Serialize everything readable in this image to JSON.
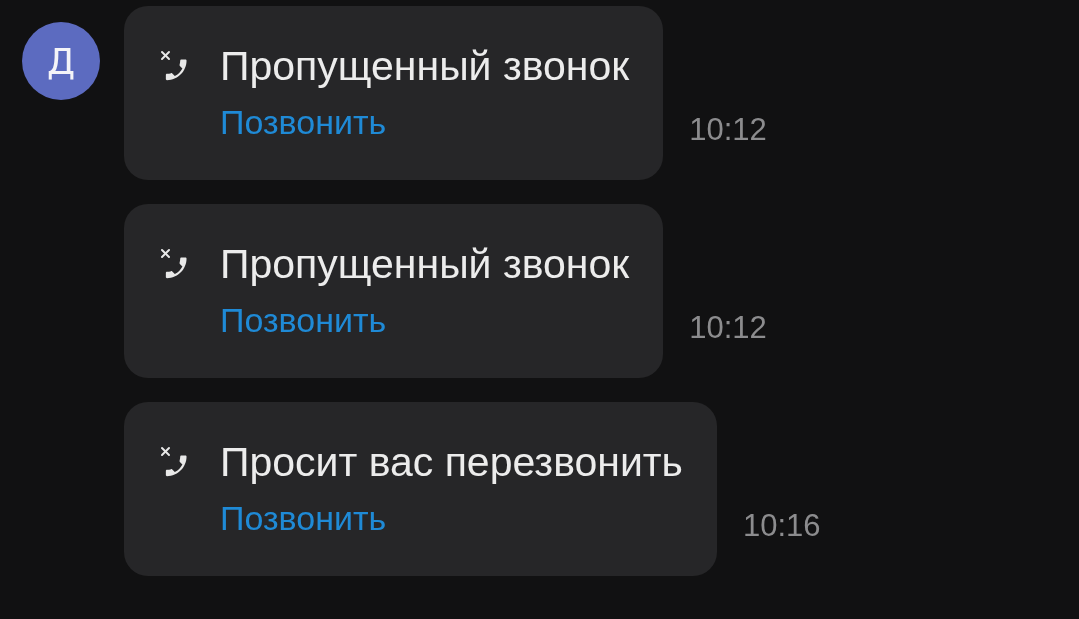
{
  "avatar": {
    "letter": "Д"
  },
  "messages": [
    {
      "title": "Пропущенный звонок",
      "action": "Позвонить",
      "time": "10:12"
    },
    {
      "title": "Пропущенный звонок",
      "action": "Позвонить",
      "time": "10:12"
    },
    {
      "title": "Просит вас перезвонить",
      "action": "Позвонить",
      "time": "10:16"
    }
  ]
}
